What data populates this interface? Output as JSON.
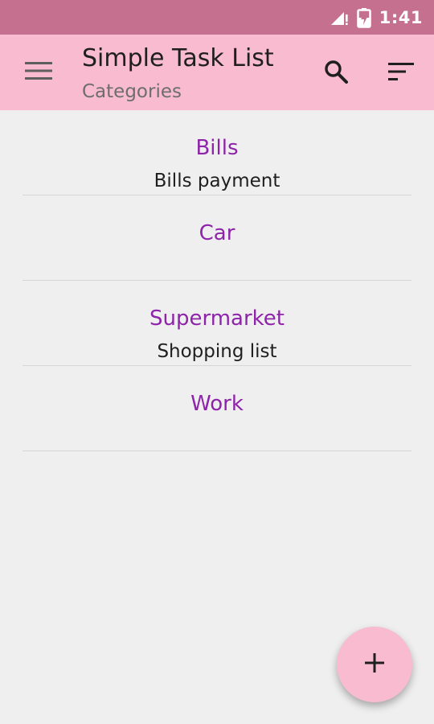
{
  "status_bar": {
    "time": "1:41",
    "signal_icon": "signal-icon",
    "battery_icon": "battery-charging-icon",
    "background": "#c5708f"
  },
  "app_bar": {
    "title": "Simple Task List",
    "subtitle": "Categories",
    "menu_icon": "menu-icon",
    "search_icon": "search-icon",
    "sort_icon": "sort-icon",
    "background": "#f8bbd0"
  },
  "categories": [
    {
      "name": "Bills",
      "description": "Bills payment"
    },
    {
      "name": "Car",
      "description": ""
    },
    {
      "name": "Supermarket",
      "description": "Shopping list"
    },
    {
      "name": "Work",
      "description": ""
    }
  ],
  "fab": {
    "icon": "add-icon"
  },
  "colors": {
    "accent": "#8e24aa",
    "background": "#efefef"
  }
}
